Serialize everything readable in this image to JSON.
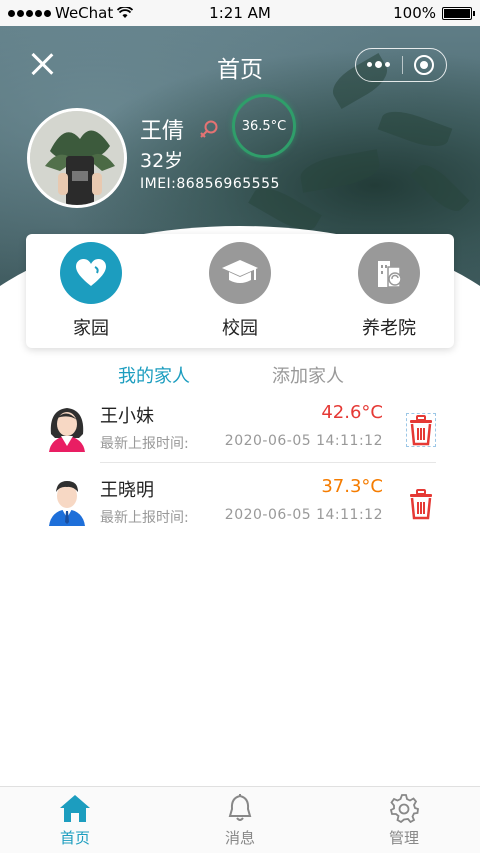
{
  "status_bar": {
    "carrier": "WeChat",
    "time": "1:21 AM",
    "battery": "100%"
  },
  "nav": {
    "title": "首页"
  },
  "profile": {
    "name": "王倩",
    "age": "32岁",
    "imei": "IMEI:86856965555",
    "temperature": "36.5°C",
    "gender_icon": "female-icon",
    "ring_color": "#2f9e6a"
  },
  "categories": [
    {
      "label": "家园",
      "icon": "heart-icon",
      "color": "#1c9dbf"
    },
    {
      "label": "校园",
      "icon": "graduation-cap-icon",
      "color": "#999999"
    },
    {
      "label": "养老院",
      "icon": "building-icon",
      "color": "#999999"
    }
  ],
  "tabs": {
    "my_family": "我的家人",
    "add_family": "添加家人",
    "active_color": "#1c9dbf"
  },
  "members": [
    {
      "name": "王小妹",
      "temperature": "42.6°C",
      "temp_color": "#e53935",
      "time_label": "最新上报时间:",
      "report_time": "2020-06-05  14:11:12",
      "avatar": "female-avatar-icon"
    },
    {
      "name": "王晓明",
      "temperature": "37.3°C",
      "temp_color": "#f57c00",
      "time_label": "最新上报时间:",
      "report_time": "2020-06-05  14:11:12",
      "avatar": "male-avatar-icon"
    }
  ],
  "tabbar": {
    "items": [
      {
        "label": "首页",
        "icon": "home-icon",
        "active": true
      },
      {
        "label": "消息",
        "icon": "bell-icon",
        "active": false
      },
      {
        "label": "管理",
        "icon": "gear-icon",
        "active": false
      }
    ],
    "active_color": "#1c9dbf",
    "inactive_color": "#888888"
  }
}
